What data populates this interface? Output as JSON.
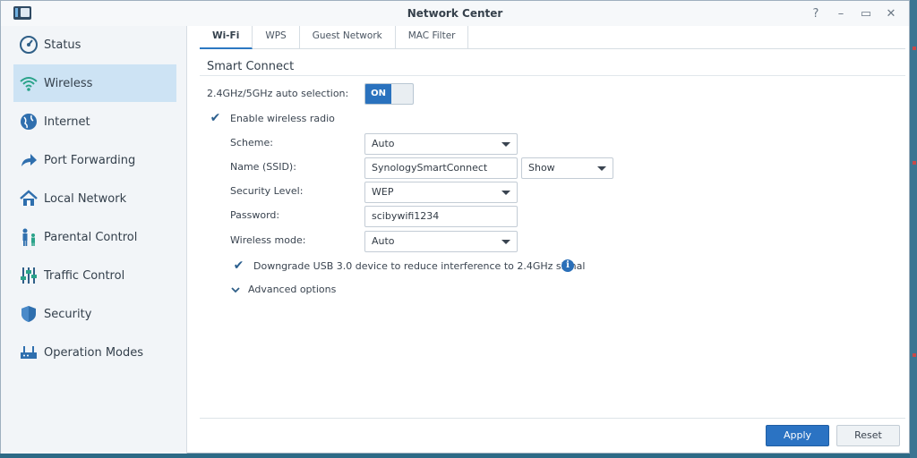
{
  "window": {
    "title": "Network Center",
    "controls": [
      "?",
      "–",
      "▭",
      "✕"
    ]
  },
  "sidebar": {
    "items": [
      {
        "label": "Status",
        "icon": "status-gauge-icon"
      },
      {
        "label": "Wireless",
        "icon": "wifi-icon",
        "active": true
      },
      {
        "label": "Internet",
        "icon": "globe-icon"
      },
      {
        "label": "Port Forwarding",
        "icon": "forward-arrow-icon"
      },
      {
        "label": "Local Network",
        "icon": "house-icon"
      },
      {
        "label": "Parental Control",
        "icon": "family-icon"
      },
      {
        "label": "Traffic Control",
        "icon": "sliders-icon"
      },
      {
        "label": "Security",
        "icon": "shield-icon"
      },
      {
        "label": "Operation Modes",
        "icon": "router-icon"
      }
    ]
  },
  "tabs": [
    {
      "label": "Wi-Fi",
      "active": true
    },
    {
      "label": "WPS"
    },
    {
      "label": "Guest Network"
    },
    {
      "label": "MAC Filter"
    }
  ],
  "smart_connect": {
    "title": "Smart Connect",
    "auto_selection_label": "2.4GHz/5GHz auto selection:",
    "auto_selection_toggle": "ON",
    "enable_radio_label": "Enable wireless radio",
    "enable_radio_checked": true,
    "scheme_label": "Scheme:",
    "scheme_value": "Auto",
    "ssid_label": "Name (SSID):",
    "ssid_value": "SynologySmartConnect",
    "ssid_visibility": "Show",
    "security_label": "Security Level:",
    "security_value": "WEP",
    "password_label": "Password:",
    "password_value": "scibywifi1234",
    "mode_label": "Wireless mode:",
    "mode_value": "Auto",
    "downgrade_label": "Downgrade USB 3.0 device to reduce interference to 2.4GHz signal",
    "downgrade_checked": true,
    "advanced_label": "Advanced options"
  },
  "footer": {
    "apply_label": "Apply",
    "reset_label": "Reset"
  },
  "colors": {
    "accent": "#2b73c3",
    "sidebar_active": "#cde3f4",
    "toggle_on": "#2a72be"
  }
}
